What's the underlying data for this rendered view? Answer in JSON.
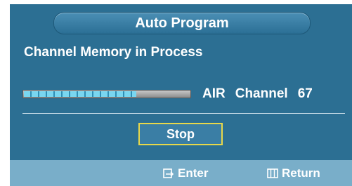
{
  "title": "Auto Program",
  "heading": "Channel Memory in Process",
  "progress": {
    "fraction": 0.68
  },
  "status": {
    "source": "AIR",
    "channel_label": "Channel",
    "channel_number": "67"
  },
  "buttons": {
    "stop_label": "Stop"
  },
  "footer": {
    "enter_label": "Enter",
    "enter_icon": "enter-icon",
    "return_label": "Return",
    "return_icon": "menu-icon"
  },
  "colors": {
    "panel_bg": "#2c6f93",
    "footer_bg": "#79aec9",
    "focus_border": "#e8d84a",
    "progress_fill": "#79d6f0"
  }
}
